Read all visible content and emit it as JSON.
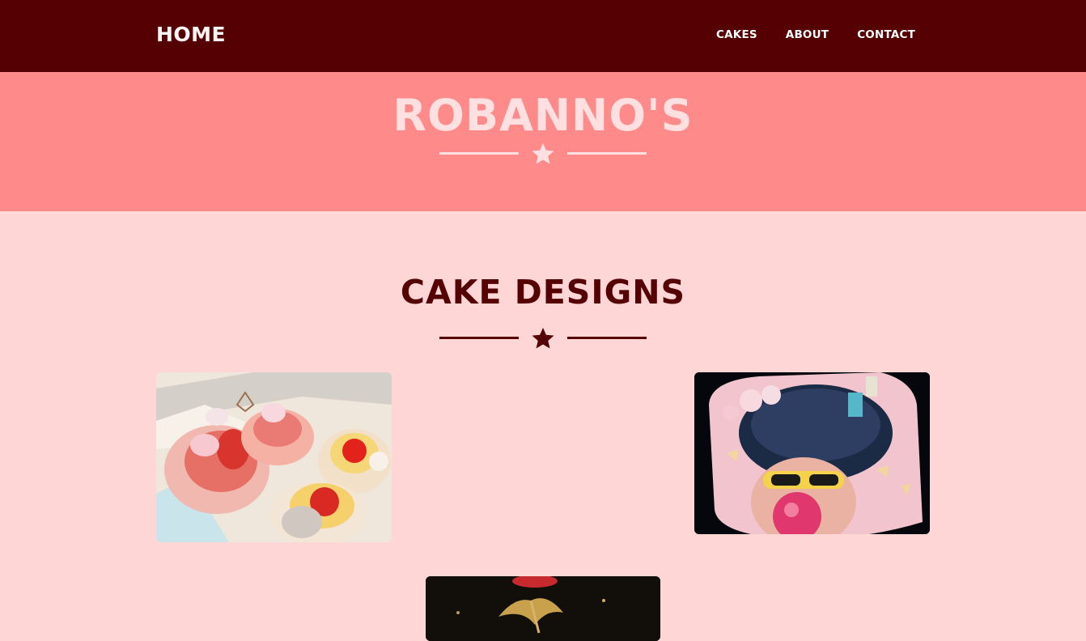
{
  "navbar": {
    "brand": "HOME",
    "links": [
      {
        "label": "CAKES"
      },
      {
        "label": "ABOUT"
      },
      {
        "label": "CONTACT"
      }
    ]
  },
  "hero": {
    "title": "ROBANNO'S"
  },
  "section": {
    "title": "CAKE DESIGNS"
  },
  "gallery": {
    "items": [
      {
        "name": "cupcakes-box-photo"
      },
      {
        "name": "bubblegum-girl-cake-photo"
      },
      {
        "name": "dark-cake-photo"
      }
    ]
  },
  "colors": {
    "navbar_bg": "#550003",
    "hero_bg": "#ff8a8a",
    "page_bg": "#ffd6d6",
    "hero_text": "#ffe0e0",
    "heading_text": "#550003"
  },
  "icons": {
    "divider": "star-icon"
  }
}
